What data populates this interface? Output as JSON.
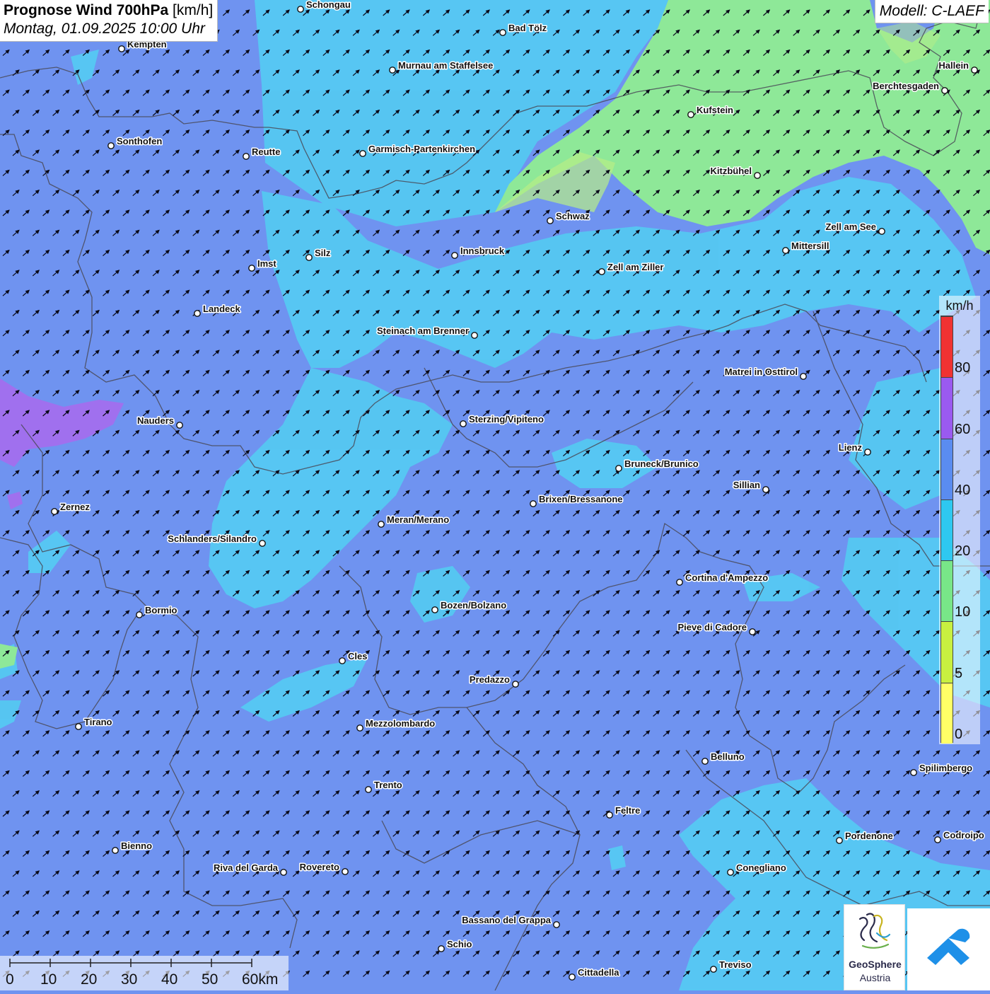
{
  "header": {
    "title_main": "Prognose Wind 700hPa",
    "title_unit": "[km/h]",
    "subtitle": "Montag, 01.09.2025 10:00 Uhr",
    "model": "Modell: C-LAEF"
  },
  "legend": {
    "unit": "km/h",
    "classes": [
      {
        "color": "#ffff66",
        "label": "0"
      },
      {
        "color": "#c8f040",
        "label": "5"
      },
      {
        "color": "#78e688",
        "label": "10"
      },
      {
        "color": "#2ec8f0",
        "label": "20"
      },
      {
        "color": "#5a8cf0",
        "label": "40"
      },
      {
        "color": "#9a5af0",
        "label": "60"
      },
      {
        "color": "#f03232",
        "label": "80"
      }
    ]
  },
  "scalebar": {
    "labels": [
      "0",
      "10",
      "20",
      "30",
      "40",
      "50",
      "60km"
    ]
  },
  "logos": {
    "geosphere_name": "GeoSphere",
    "geosphere_country": "Austria",
    "geosphere_icon": "geosphere-logo-icon",
    "app_icon": "app-logo-icon"
  },
  "map": {
    "colors": {
      "base": "#6f93f0",
      "light_blue": "#55c8f2",
      "green": "#8ee898",
      "light_green": "#b8ee86",
      "violet": "#a070ee",
      "border": "#4a4a58",
      "arrow": "#0a0a1a"
    },
    "wind_direction": "southwest"
  },
  "cities": [
    {
      "name": "Schongau"
    },
    {
      "name": "Bad Tölz"
    },
    {
      "name": "Kempten"
    },
    {
      "name": "Murnau am Staffelsee"
    },
    {
      "name": "Hallein"
    },
    {
      "name": "Berchtesgaden"
    },
    {
      "name": "Kufstein"
    },
    {
      "name": "Sonthofen"
    },
    {
      "name": "Reutte"
    },
    {
      "name": "Garmisch-Partenkirchen"
    },
    {
      "name": "Kitzbühel"
    },
    {
      "name": "Schwaz"
    },
    {
      "name": "Zell am See"
    },
    {
      "name": "Mittersill"
    },
    {
      "name": "Silz"
    },
    {
      "name": "Innsbruck"
    },
    {
      "name": "Imst"
    },
    {
      "name": "Zell am Ziller"
    },
    {
      "name": "Landeck"
    },
    {
      "name": "Steinach am Brenner"
    },
    {
      "name": "Matrei in Osttirol"
    },
    {
      "name": "Nauders"
    },
    {
      "name": "Sterzing/Vipiteno"
    },
    {
      "name": "Lienz"
    },
    {
      "name": "Bruneck/Brunico"
    },
    {
      "name": "Sillian"
    },
    {
      "name": "Zernez"
    },
    {
      "name": "Brixen/Bressanone"
    },
    {
      "name": "Meran/Merano"
    },
    {
      "name": "Schlanders/Silandro"
    },
    {
      "name": "Cortina d'Ampezzo"
    },
    {
      "name": "Bozen/Bolzano"
    },
    {
      "name": "Bormio"
    },
    {
      "name": "Pieve di Cadore"
    },
    {
      "name": "Cles"
    },
    {
      "name": "Predazzo"
    },
    {
      "name": "Tirano"
    },
    {
      "name": "Mezzolombardo"
    },
    {
      "name": "Belluno"
    },
    {
      "name": "Spilimbergo"
    },
    {
      "name": "Trento"
    },
    {
      "name": "Feltre"
    },
    {
      "name": "Pordenone"
    },
    {
      "name": "Codroipo"
    },
    {
      "name": "Bienno"
    },
    {
      "name": "Riva del Garda"
    },
    {
      "name": "Rovereto"
    },
    {
      "name": "Conegliano"
    },
    {
      "name": "Bassano del Grappa"
    },
    {
      "name": "Schio"
    },
    {
      "name": "Treviso"
    },
    {
      "name": "Cittadella"
    }
  ]
}
